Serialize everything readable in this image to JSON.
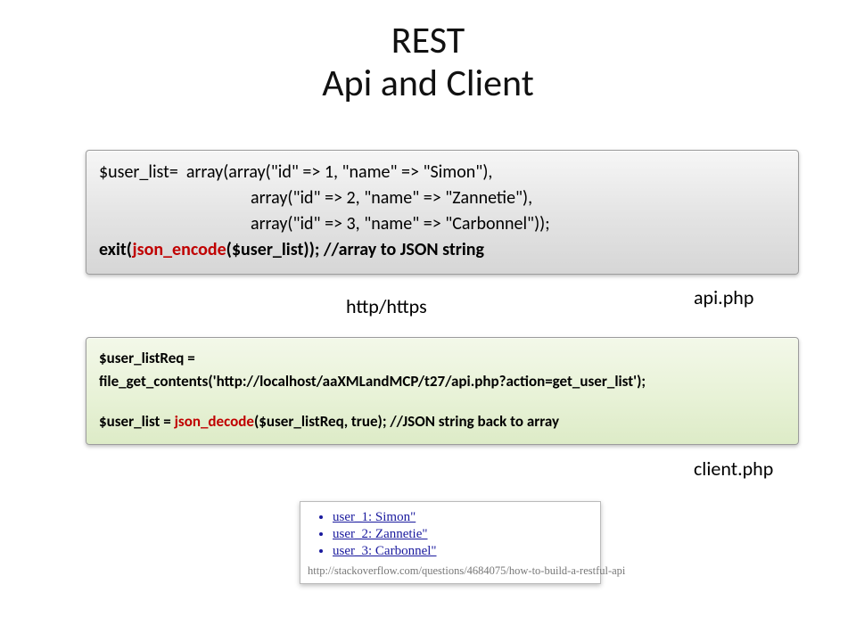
{
  "title_line1": "REST",
  "title_line2": "Api and Client",
  "labels": {
    "http": "http/https",
    "api": "api.php",
    "client": "client.php"
  },
  "code_api": {
    "l1_a": "$user_list=  array(array(\"id\" => 1, \"name\" => \"Simon\"),",
    "l2": "array(\"id\" => 2, \"name\" => \"Zannetie\"),",
    "l3": "array(\"id\" => 3, \"name\" => \"Carbonnel\"));",
    "l4_a": "exit(",
    "l4_red": "json_encode",
    "l4_b": "($user_list)); //array to JSON string"
  },
  "code_client": {
    "l1": "$user_listReq =",
    "l2": "file_get_contents('http://localhost/aaXMLandMCP/t27/api.php?action=get_user_list');",
    "l3_a": "$user_list = ",
    "l3_red": "json_decode",
    "l3_b": "($user_listReq, true); //JSON string back to array"
  },
  "output": {
    "items": [
      "user_1: Simon\"",
      "user_2: Zannetie\"",
      "user_3: Carbonnel\""
    ],
    "url": "http://stackoverflow.com/questions/4684075/how-to-build-a-restful-api"
  }
}
